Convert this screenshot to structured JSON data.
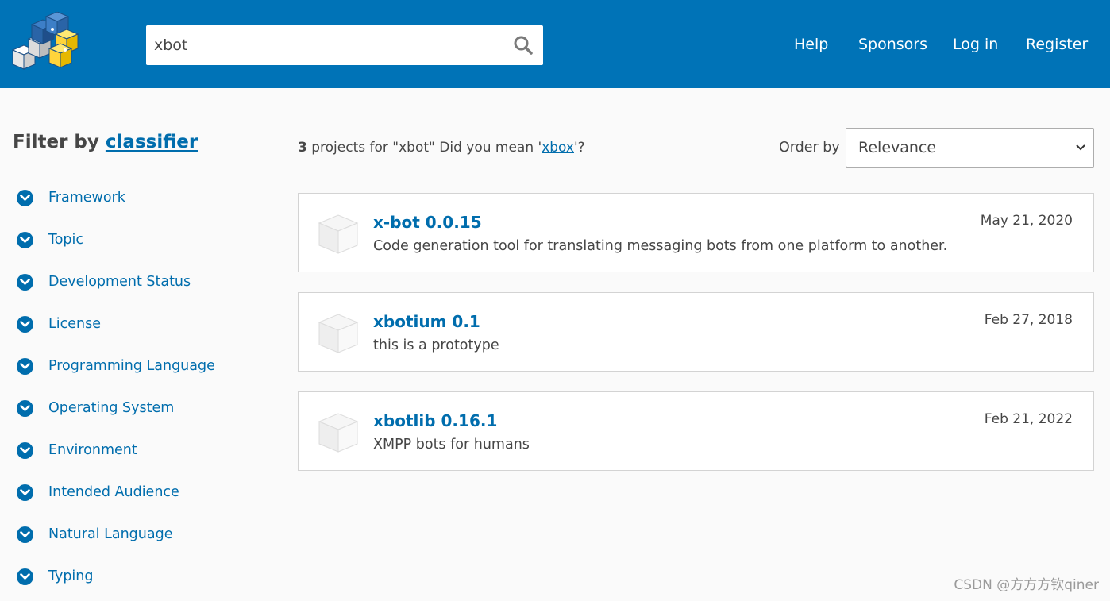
{
  "header": {
    "search": {
      "value": "xbot"
    },
    "nav": [
      "Help",
      "Sponsors",
      "Log in",
      "Register"
    ]
  },
  "sidebar": {
    "title_prefix": "Filter by",
    "title_link": "classifier",
    "facets": [
      "Framework",
      "Topic",
      "Development Status",
      "License",
      "Programming Language",
      "Operating System",
      "Environment",
      "Intended Audience",
      "Natural Language",
      "Typing"
    ]
  },
  "results": {
    "count": "3",
    "summary_text": " projects for \"xbot\" Did you mean '",
    "suggestion": "xbox",
    "summary_suffix": "'?",
    "order_label": "Order by",
    "order_value": "Relevance",
    "packages": [
      {
        "name": "x-bot 0.0.15",
        "description": "Code generation tool for translating messaging bots from one platform to another.",
        "date": "May 21, 2020"
      },
      {
        "name": "xbotium 0.1",
        "description": "this is a prototype",
        "date": "Feb 27, 2018"
      },
      {
        "name": "xbotlib 0.16.1",
        "description": "XMPP bots for humans",
        "date": "Feb 21, 2022"
      }
    ]
  },
  "watermark": "CSDN @方方方钦qiner",
  "colors": {
    "header_bg": "#0073b7",
    "link": "#006dad",
    "text": "#464646",
    "page_bg": "#fafafa"
  },
  "icons": [
    "pypi-logo-icon",
    "search-icon",
    "chevron-down-icon",
    "package-cube-icon",
    "select-caret-icon"
  ]
}
